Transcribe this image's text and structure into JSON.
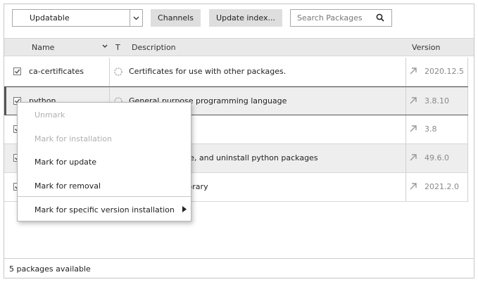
{
  "toolbar": {
    "filter_value": "Updatable",
    "channels_label": "Channels",
    "update_index_label": "Update index...",
    "search_placeholder": "Search Packages"
  },
  "table": {
    "col_name": "Name",
    "col_type": "T",
    "col_description": "Description",
    "col_version": "Version",
    "rows": [
      {
        "name": "ca-certificates",
        "description": "Certificates for use with other packages.",
        "version": "2020.12.5"
      },
      {
        "name": "python",
        "description": "General purpose programming language",
        "version": "3.8.10"
      },
      {
        "name": "",
        "description": "",
        "version": "3.8"
      },
      {
        "name": "",
        "description": ", install, upgrade, and uninstall python packages",
        "version": "49.6.0"
      },
      {
        "name": "",
        "description": "ect threading library",
        "version": "2021.2.0"
      }
    ]
  },
  "status": {
    "text": "5 packages available"
  },
  "context_menu": {
    "unmark": "Unmark",
    "mark_install": "Mark for installation",
    "mark_update": "Mark for update",
    "mark_removal": "Mark for removal",
    "mark_specific": "Mark for specific version installation"
  },
  "colors": {
    "accent_gray": "#dedede",
    "muted_text": "#b0b0b0",
    "version_text": "#888888"
  }
}
